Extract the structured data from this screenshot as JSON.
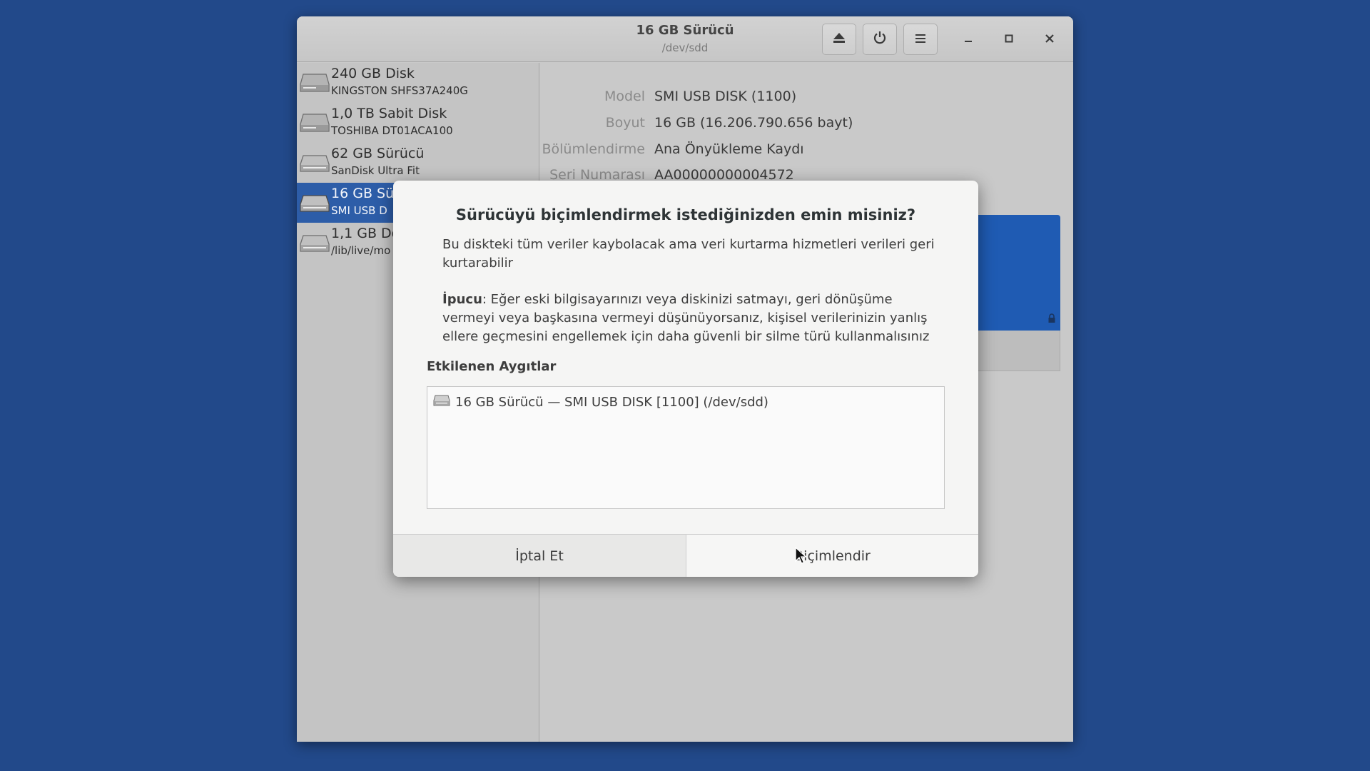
{
  "window": {
    "title": "16 GB Sürücü",
    "subtitle": "/dev/sdd",
    "buttons": [
      "eject-icon",
      "power-icon",
      "menu-icon"
    ],
    "wm_buttons": [
      "minimize",
      "maximize",
      "close"
    ]
  },
  "sidebar": {
    "drives": [
      {
        "name": "240 GB Disk",
        "sub": "KINGSTON SHFS37A240G",
        "selected": false
      },
      {
        "name": "1,0 TB Sabit Disk",
        "sub": "TOSHIBA DT01ACA100",
        "selected": false
      },
      {
        "name": "62 GB Sürücü",
        "sub": "SanDisk Ultra Fit",
        "selected": false
      },
      {
        "name": "16 GB Sü",
        "sub": "SMI USB D",
        "selected": true
      },
      {
        "name": "1,1 GB Dö",
        "sub": "/lib/live/mo",
        "selected": false
      }
    ]
  },
  "properties": [
    {
      "label": "Model",
      "value": "SMI USB DISK (1100)"
    },
    {
      "label": "Boyut",
      "value": "16 GB (16.206.790.656 bayt)"
    },
    {
      "label": "Bölümlendirme",
      "value": "Ana Önyükleme Kaydı"
    },
    {
      "label": "Seri Numarası",
      "value": "AA00000000004572"
    }
  ],
  "dialog": {
    "title": "Sürücüyü biçimlendirmek istediğinizden emin misiniz?",
    "message": "Bu diskteki tüm veriler kaybolacak ama veri kurtarma hizmetleri verileri geri kurtarabilir",
    "tip_label": "İpucu",
    "tip_text": ": Eğer eski bilgisayarınızı veya diskinizi satmayı, geri dönüşüme vermeyi veya başkasına vermeyi düşünüyorsanız, kişisel verilerinizin yanlış ellere geçmesini engellemek için daha güvenli bir silme türü kullanmalısınız",
    "affected_heading": "Etkilenen Aygıtlar",
    "affected_devices": [
      "16 GB Sürücü — SMI USB DISK [1100] (/dev/sdd)"
    ],
    "cancel_label": "İptal Et",
    "confirm_label": "Biçimlendir"
  },
  "colors": {
    "desktop": "#22498a",
    "selection": "#2d5da8",
    "volume": "#1f5bb3"
  }
}
